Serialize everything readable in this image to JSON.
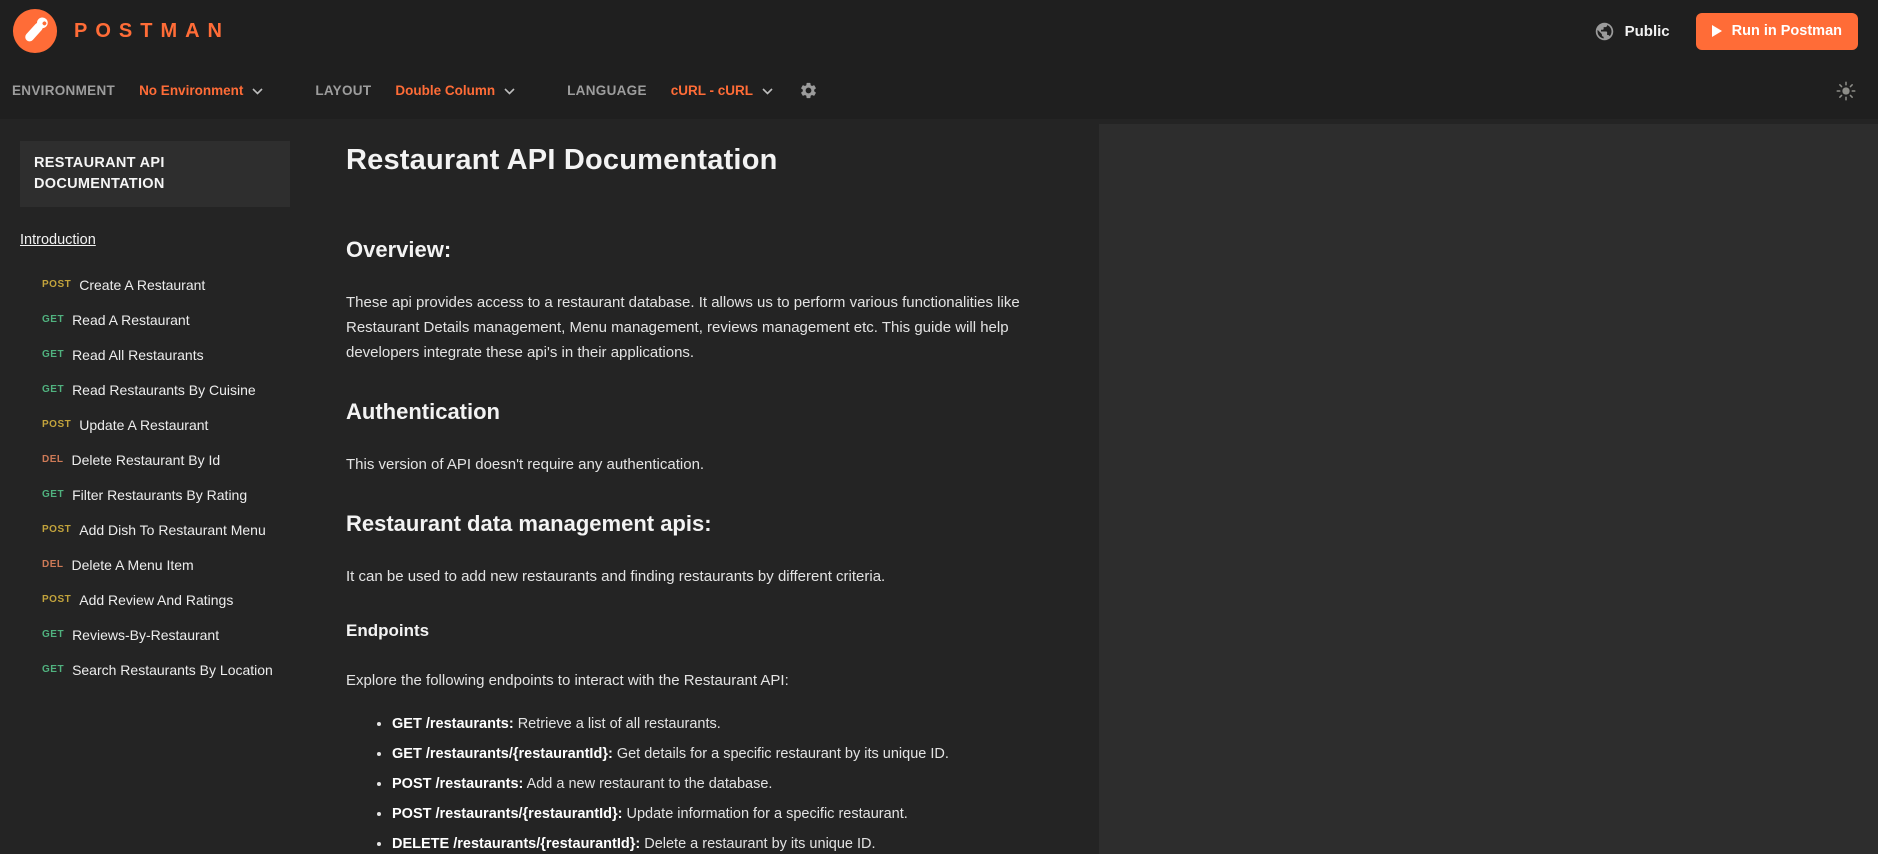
{
  "colors": {
    "brand": "#ff6c37",
    "get": "#50b27f",
    "post": "#c2a33c",
    "del": "#ce7a57",
    "header_bg": "#1f1f1f",
    "content_bg": "#242424",
    "panel_bg": "#2d2d2d"
  },
  "icons": {
    "logo": "postman-logo",
    "globe": "globe-icon",
    "play": "play-icon",
    "chevron": "chevron-down-icon",
    "gear": "gear-icon",
    "sun": "sun-icon"
  },
  "header": {
    "logo_text": "POSTMAN",
    "visibility_label": "Public",
    "run_button_label": "Run in Postman"
  },
  "toolbar": {
    "environment_label": "ENVIRONMENT",
    "environment_value": "No Environment",
    "layout_label": "LAYOUT",
    "layout_value": "Double Column",
    "language_label": "LANGUAGE",
    "language_value": "cURL - cURL"
  },
  "sidebar": {
    "title": "RESTAURANT API DOCUMENTATION",
    "intro_link": "Introduction",
    "items": [
      {
        "method": "POST",
        "label": "Create A Restaurant"
      },
      {
        "method": "GET",
        "label": "Read A Restaurant"
      },
      {
        "method": "GET",
        "label": "Read All Restaurants"
      },
      {
        "method": "GET",
        "label": "Read Restaurants By Cuisine"
      },
      {
        "method": "POST",
        "label": "Update A Restaurant"
      },
      {
        "method": "DEL",
        "label": "Delete Restaurant By Id"
      },
      {
        "method": "GET",
        "label": "Filter Restaurants By Rating"
      },
      {
        "method": "POST",
        "label": "Add Dish To Restaurant Menu"
      },
      {
        "method": "DEL",
        "label": "Delete A Menu Item"
      },
      {
        "method": "POST",
        "label": "Add Review And Ratings"
      },
      {
        "method": "GET",
        "label": "Reviews-By-Restaurant"
      },
      {
        "method": "GET",
        "label": "Search Restaurants By Location"
      }
    ]
  },
  "main": {
    "title": "Restaurant API Documentation",
    "overview_heading": "Overview:",
    "overview_text": "These api provides access to a restaurant database. It allows us to perform various functionalities like Restaurant Details management, Menu management, reviews management etc. This guide will help developers integrate these api's in their applications.",
    "auth_heading": "Authentication",
    "auth_text": "This version of API doesn't require any authentication.",
    "mgmt_heading": "Restaurant data management apis:",
    "mgmt_text": "It can be used to add new restaurants and finding restaurants by different criteria.",
    "endpoints_heading": "Endpoints",
    "endpoints_intro": "Explore the following endpoints to interact with the Restaurant API:",
    "endpoints": [
      {
        "bold": "GET /restaurants:",
        "text": " Retrieve a list of all restaurants."
      },
      {
        "bold": "GET /restaurants/{restaurantId}:",
        "text": " Get details for a specific restaurant by its unique ID."
      },
      {
        "bold": "POST /restaurants:",
        "text": " Add a new restaurant to the database."
      },
      {
        "bold": "POST /restaurants/{restaurantId}:",
        "text": " Update information for a specific restaurant."
      },
      {
        "bold": "DELETE /restaurants/{restaurantId}:",
        "text": " Delete a restaurant by its unique ID."
      }
    ]
  }
}
